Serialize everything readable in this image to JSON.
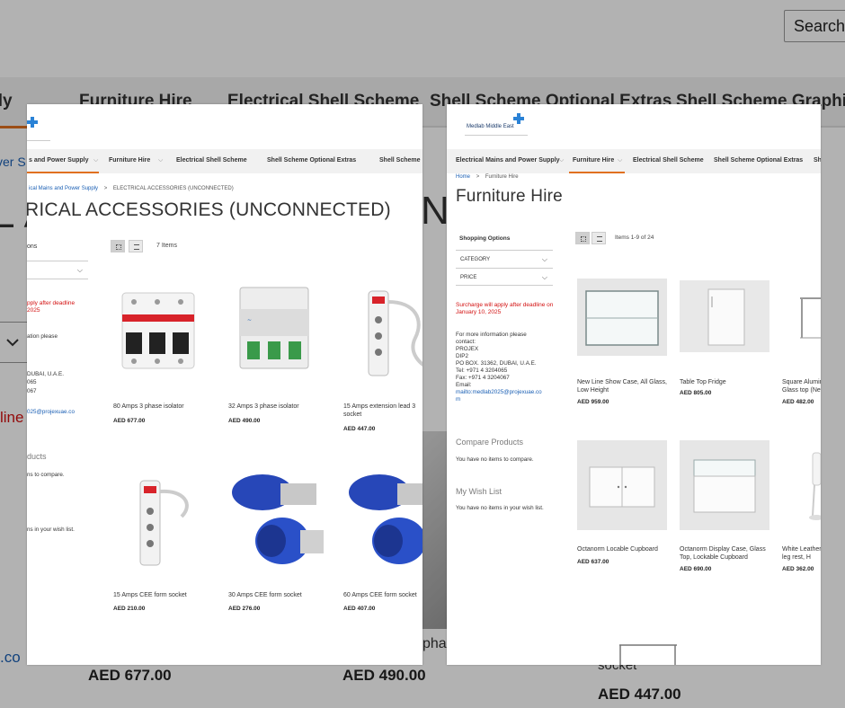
{
  "background": {
    "search_label": "Search",
    "nav": [
      "Electrical Mains and Power Supply",
      "Furniture Hire",
      "Electrical Shell Scheme",
      "Shell Scheme Optional Extras",
      "Shell Scheme Graphics"
    ],
    "title_fragment_left": "L A",
    "title_fragment_right": "N",
    "side_fragment_power": "ver S",
    "side_fragment_deadline": "line",
    "side_fragment_email": ".co",
    "prices": [
      "AED 677.00",
      "AED 490.00",
      "AED 447.00"
    ],
    "socket_label": "socket",
    "phase_fragment": "phas"
  },
  "left_panel": {
    "nav": [
      "s and Power Supply",
      "Furniture Hire",
      "Electrical Shell Scheme",
      "Shell Scheme Optional Extras",
      "Shell Scheme"
    ],
    "breadcrumb": {
      "link": "ical Mains and Power Supply",
      "separator": ">",
      "current": "ELECTRICAL ACCESSORIES (UNCONNECTED)"
    },
    "title": "RICAL ACCESSORIES (UNCONNECTED)",
    "items_count": "7 Items",
    "sidebar": {
      "options_fragment": "ons",
      "red_line1": "pply after deadline",
      "red_line2": "2025",
      "info_fragment": "ation please",
      "address1": "DUBAI, U.A.E.",
      "tel_fragment": "065",
      "fax_fragment": "067",
      "email_fragment": "025@projexuae.co",
      "compare_fragment": "ducts",
      "compare_text": "ns to compare.",
      "wish_text": "ns in your wish list."
    },
    "products": [
      {
        "name": "80 Amps 3 phase isolator",
        "price": "AED 677.00",
        "icon": "isolator-3p-red"
      },
      {
        "name": "32 Amps 3 phase isolator",
        "price": "AED 490.00",
        "icon": "isolator-3p-green"
      },
      {
        "name": "15 Amps extension lead 3 socket",
        "price": "AED 447.00",
        "icon": "extension-lead"
      },
      {
        "name": "15 Amps CEE form socket",
        "price": "AED 210.00",
        "icon": "power-strip"
      },
      {
        "name": "30 Amps CEE form socket",
        "price": "AED 276.00",
        "icon": "cee-plug-blue"
      },
      {
        "name": "60 Amps CEE form socket",
        "price": "AED 407.00",
        "icon": "cee-plug-blue"
      }
    ]
  },
  "right_panel": {
    "logo_text": "Medlab Middle East",
    "nav": [
      "Electrical Mains and Power Supply",
      "Furniture Hire",
      "Electrical Shell Scheme",
      "Shell Scheme Optional Extras",
      "Sh"
    ],
    "breadcrumb": {
      "home": "Home",
      "separator": ">",
      "current": "Furniture Hire"
    },
    "title": "Furniture Hire",
    "items_count": "Items 1-9 of 24",
    "sidebar": {
      "shopping_options": "Shopping Options",
      "filters": [
        "CATEGORY",
        "PRICE"
      ],
      "surcharge": "Surcharge will apply after deadline on January 10, 2025",
      "info_lines": [
        "For more information please",
        "contact:",
        "PROJEX",
        "DIP2",
        "PO BOX. 31362, DUBAI, U.A.E.",
        "Tel: +971 4 3204065",
        "Fax: +971 4 3204067",
        "Email:"
      ],
      "email_link": "mailto:medlab2025@projexuae.co",
      "email_tail": "m",
      "compare_title": "Compare Products",
      "compare_text": "You have no items to compare.",
      "wishlist_title": "My Wish List",
      "wishlist_text": "You have no items in your wish list."
    },
    "products": [
      {
        "name": "New Line Show Case, All Glass, Low Height",
        "price": "AED 959.00",
        "icon": "glass-showcase"
      },
      {
        "name": "Table Top Fridge",
        "price": "AED 805.00",
        "icon": "fridge"
      },
      {
        "name": "Square Alumin Glass top (New",
        "price": "AED 482.00",
        "icon": "square-table"
      },
      {
        "name": "Octanorm Locable Cupboard",
        "price": "AED 637.00",
        "icon": "cupboard"
      },
      {
        "name": "Octanorm Display Case, Glass Top, Lockable Cupboard",
        "price": "AED 690.00",
        "icon": "display-case"
      },
      {
        "name": "White Leather ing leg rest, H",
        "price": "AED 362.00",
        "icon": "white-chair"
      }
    ]
  }
}
